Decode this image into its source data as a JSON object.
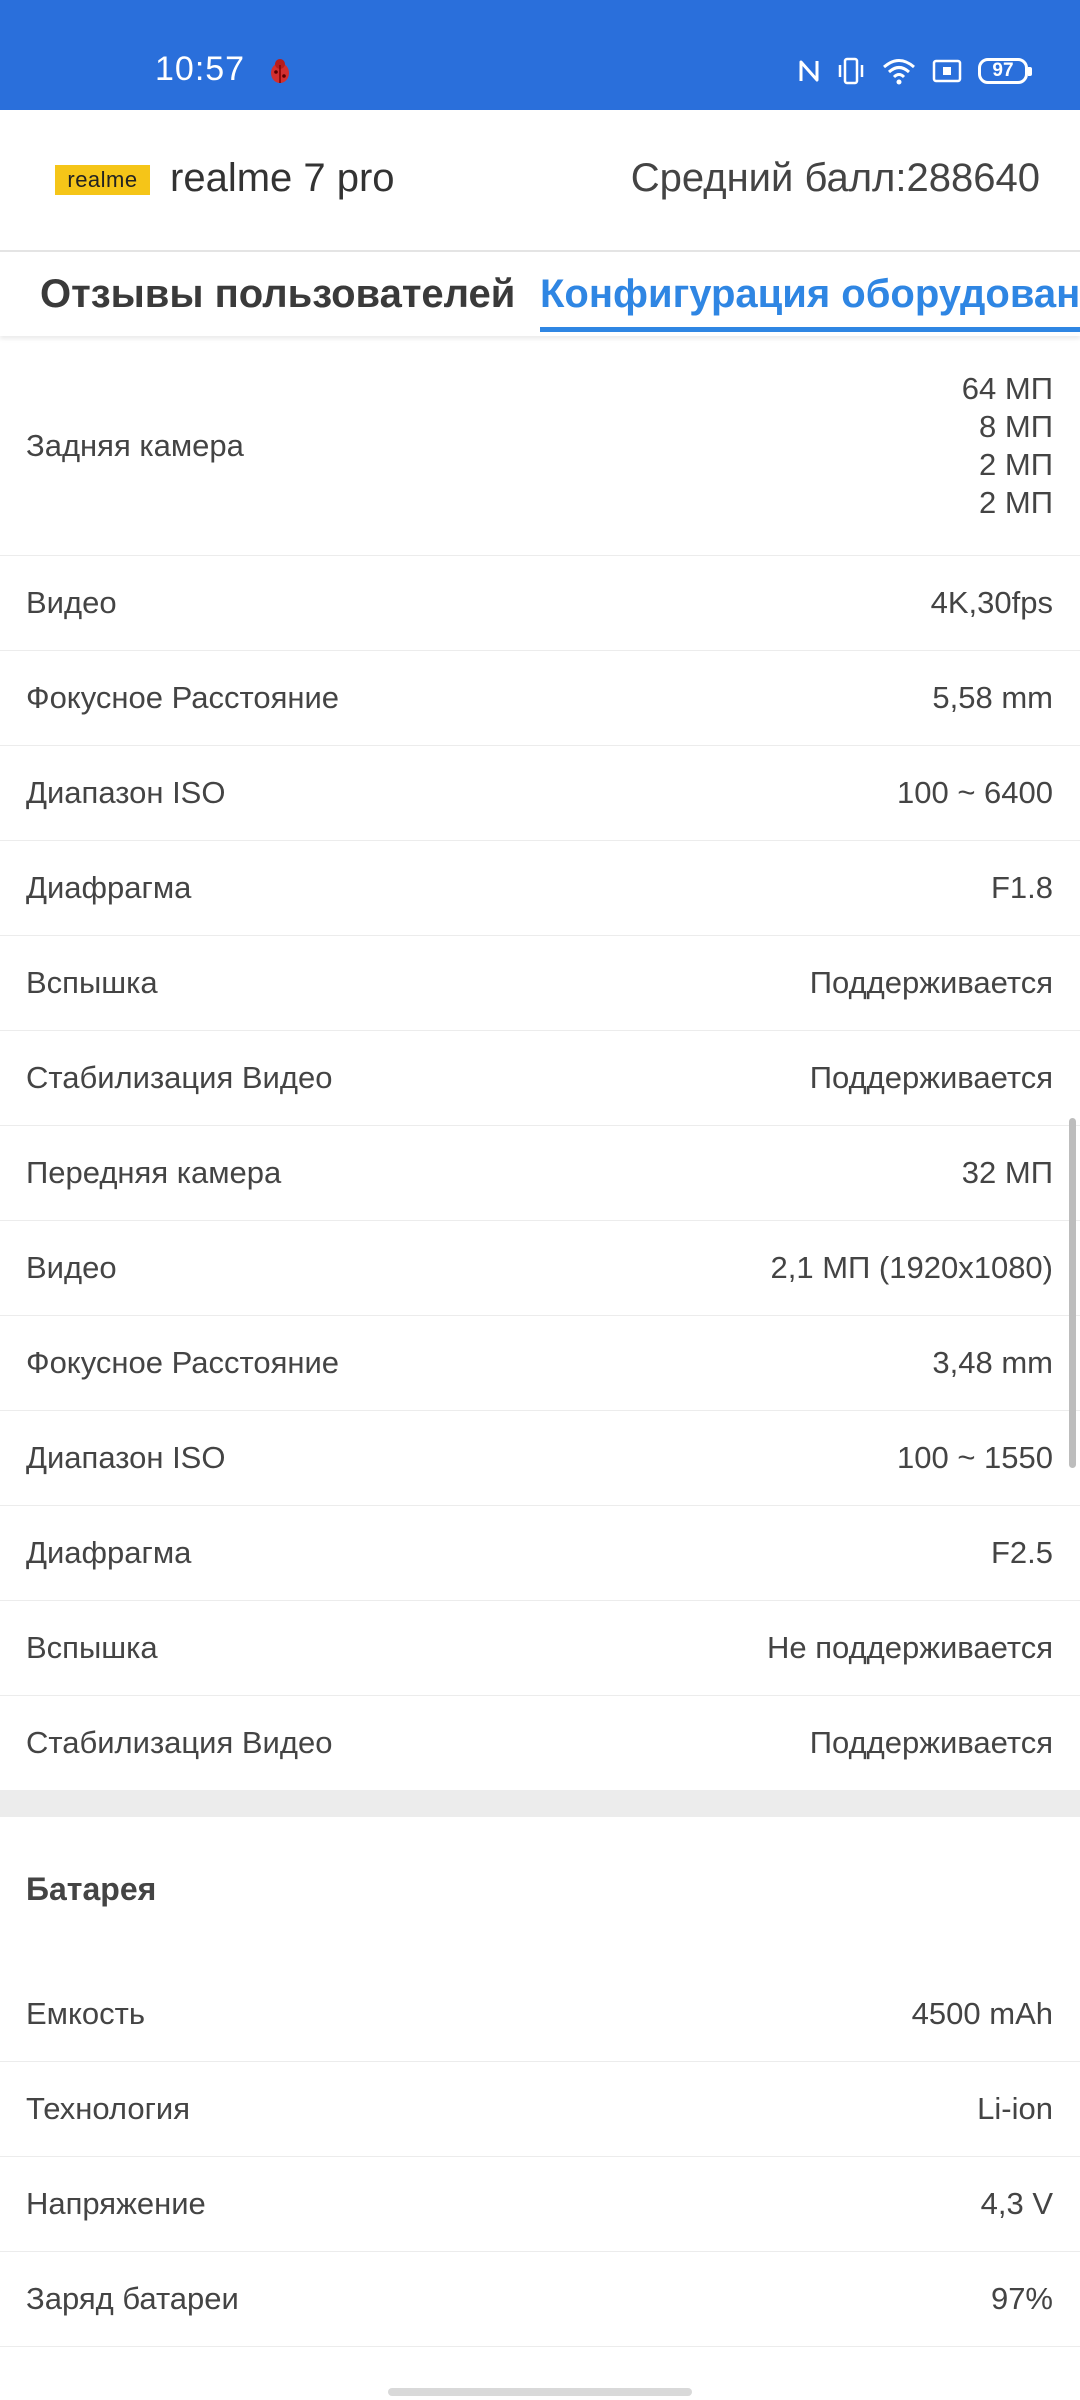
{
  "status_bar": {
    "time": "10:57",
    "battery": "97",
    "icons": [
      "bug-icon",
      "nfc-icon",
      "vibrate-icon",
      "wifi-icon",
      "cast-icon",
      "battery-icon"
    ],
    "bg_color": "#2a6fdb"
  },
  "header": {
    "brand": "realme",
    "device": "realme 7 pro",
    "avg_score": "Средний балл:288640"
  },
  "tabs": {
    "reviews": "Отзывы пользователей",
    "config": "Конфигурация оборудовани",
    "active_color": "#2f86e3"
  },
  "rear_camera": {
    "label": "Задняя камера",
    "values": [
      "64 МП",
      "8 МП",
      "2 МП",
      "2 МП"
    ]
  },
  "rear_rows": [
    {
      "label": "Видео",
      "value": "4K,30fps"
    },
    {
      "label": "Фокусное Расстояние",
      "value": "5,58 mm"
    },
    {
      "label": "Диапазон ISO",
      "value": "100 ~ 6400"
    },
    {
      "label": "Диафрагма",
      "value": "F1.8"
    },
    {
      "label": "Вспышка",
      "value": "Поддерживается"
    },
    {
      "label": "Стабилизация Видео",
      "value": "Поддерживается"
    }
  ],
  "front_rows": [
    {
      "label": "Передняя камера",
      "value": "32 МП"
    },
    {
      "label": "Видео",
      "value": "2,1 МП (1920x1080)"
    },
    {
      "label": "Фокусное Расстояние",
      "value": "3,48 mm"
    },
    {
      "label": "Диапазон ISO",
      "value": "100 ~ 1550"
    },
    {
      "label": "Диафрагма",
      "value": "F2.5"
    },
    {
      "label": "Вспышка",
      "value": "Не поддерживается"
    },
    {
      "label": "Стабилизация Видео",
      "value": "Поддерживается"
    }
  ],
  "battery_section": {
    "title": "Батарея",
    "rows": [
      {
        "label": "Емкость",
        "value": "4500 mAh"
      },
      {
        "label": "Технология",
        "value": "Li-ion"
      },
      {
        "label": "Напряжение",
        "value": "4,3 V"
      },
      {
        "label": "Заряд батареи",
        "value": "97%"
      }
    ]
  }
}
